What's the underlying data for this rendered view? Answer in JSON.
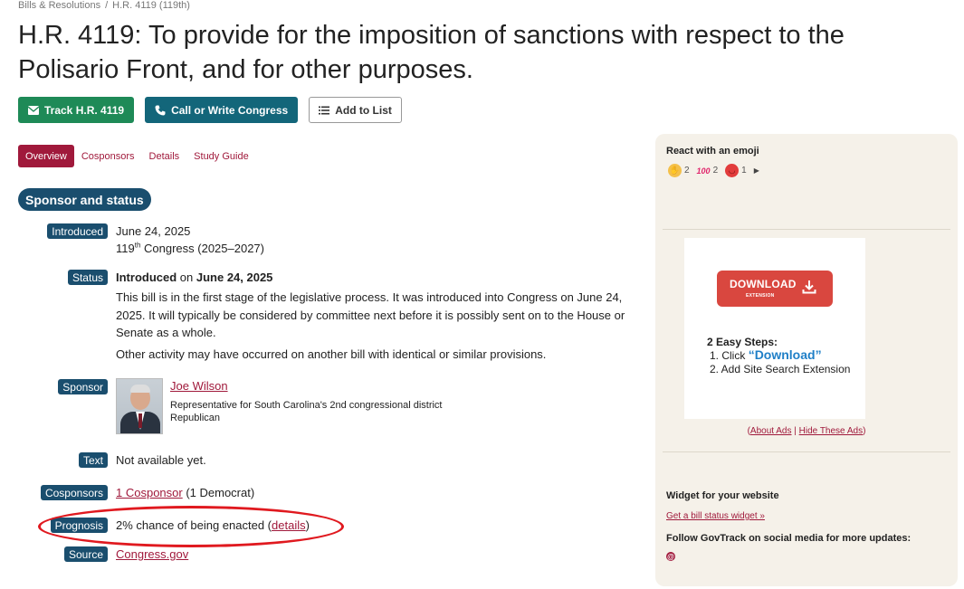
{
  "breadcrumb": {
    "item1": "Bills & Resolutions",
    "separator": "/",
    "item2": "H.R. 4119 (119th)"
  },
  "title": "H.R. 4119: To provide for the imposition of sanctions with respect to the Polisario Front, and for other purposes.",
  "actions": {
    "track": "Track H.R. 4119",
    "call": "Call or Write Congress",
    "add_list": "Add to List"
  },
  "tabs": [
    "Overview",
    "Cosponsors",
    "Details",
    "Study Guide"
  ],
  "section_title": "Sponsor and status",
  "introduced": {
    "label": "Introduced",
    "date": "June 24, 2025",
    "congress_num": "119",
    "congress_sup": "th",
    "congress_rest": " Congress (2025–2027)"
  },
  "status": {
    "label": "Status",
    "bold1": "Introduced",
    "mid": " on ",
    "bold2": "June 24, 2025",
    "description": "This bill is in the first stage of the legislative process. It was introduced into Congress on June 24, 2025. It will typically be considered by committee next before it is possibly sent on to the House or Senate as a whole.",
    "other": "Other activity may have occurred on another bill with identical or similar provisions."
  },
  "sponsor": {
    "label": "Sponsor",
    "name": "Joe Wilson",
    "role": "Representative for South Carolina's 2nd congressional district",
    "party": "Republican"
  },
  "text_row": {
    "label": "Text",
    "value": "Not available yet."
  },
  "cosponsors": {
    "label": "Cosponsors",
    "link": "1 Cosponsor",
    "rest": " (1 Democrat)"
  },
  "prognosis": {
    "label": "Prognosis",
    "text": "2% chance of being enacted (",
    "link": "details",
    "close": ")"
  },
  "source": {
    "label": "Source",
    "link": "Congress.gov"
  },
  "sidebar": {
    "react_title": "React with an emoji",
    "reactions": [
      {
        "icon": "clapping-hands-icon",
        "count": "2"
      },
      {
        "icon": "hundred-points-icon",
        "count": "2"
      },
      {
        "icon": "angry-face-icon",
        "count": "1"
      }
    ],
    "more_arrow": "▶",
    "ad": {
      "button_main": "DOWNLOAD",
      "button_sub": "EXTENSION",
      "steps_title": "2 Easy Steps:",
      "step1_prefix": "1. Click ",
      "step1_highlight": "“Download”",
      "step2": "2. Add Site Search Extension"
    },
    "ad_links": {
      "open": "(",
      "about": "About Ads",
      "sep": " | ",
      "hide": "Hide These Ads",
      "close": ")"
    },
    "widget_title": "Widget for your website",
    "widget_link": "Get a bill status widget »",
    "follow_title": "Follow GovTrack on social media for more updates:"
  }
}
